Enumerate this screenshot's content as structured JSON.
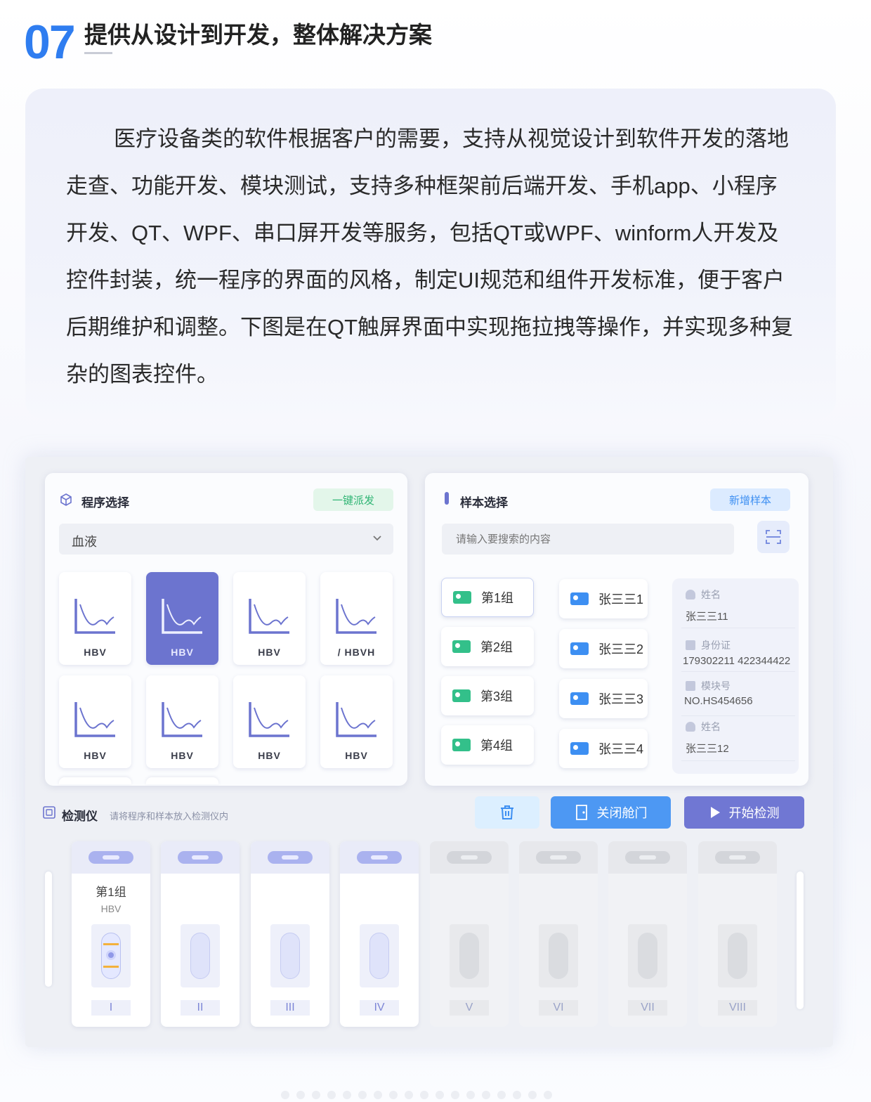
{
  "section": {
    "number": "07",
    "title": "提供从设计到开发，整体解决方案"
  },
  "intro": "医疗设备类的软件根据客户的需要，支持从视觉设计到软件开发的落地走查、功能开发、模块测试，支持多种框架前后端开发、手机app、小程序开发、QT、WPF、串口屏开发等服务，包括QT或WPF、winform人开发及控件封装，统一程序的界面的风格，制定UI规范和组件开发标准，便于客户后期维护和调整。下图是在QT触屏界面中实现拖拉拽等操作，并实现多种复杂的图表控件。",
  "program_panel": {
    "title": "程序选择",
    "dispatch_button": "一键派发",
    "dropdown_value": "血液",
    "cards": [
      {
        "label": "HBV",
        "selected": false
      },
      {
        "label": "HBV",
        "selected": true
      },
      {
        "label": "HBV",
        "selected": false
      },
      {
        "label": "/ HBVH",
        "selected": false
      },
      {
        "label": "HBV",
        "selected": false
      },
      {
        "label": "HBV",
        "selected": false
      },
      {
        "label": "HBV",
        "selected": false
      },
      {
        "label": "HBV",
        "selected": false
      }
    ]
  },
  "sample_panel": {
    "title": "样本选择",
    "add_button": "新增样本",
    "search_placeholder": "请输入要搜索的内容",
    "groups": [
      "第1组",
      "第2组",
      "第3组",
      "第4组"
    ],
    "people": [
      "张三三1",
      "张三三2",
      "张三三3",
      "张三三4"
    ],
    "info": [
      {
        "label": "姓名",
        "value": "张三三11"
      },
      {
        "label": "身份证",
        "value": "179302211 422344422"
      },
      {
        "label": "模块号",
        "value": "NO.HS454656"
      },
      {
        "label": "姓名",
        "value": "张三三12"
      }
    ]
  },
  "detector": {
    "title": "检测仪",
    "hint": "请将程序和样本放入检测仪内",
    "close_door": "关闭舱门",
    "start": "开始检测",
    "slots": [
      {
        "numeral": "I",
        "group": "第1组",
        "program": "HBV",
        "active": true
      },
      {
        "numeral": "II",
        "active": true
      },
      {
        "numeral": "III",
        "active": true
      },
      {
        "numeral": "IV",
        "active": true
      },
      {
        "numeral": "V",
        "active": false
      },
      {
        "numeral": "VI",
        "active": false
      },
      {
        "numeral": "VII",
        "active": false
      },
      {
        "numeral": "VIII",
        "active": false
      }
    ]
  },
  "colors": {
    "accent": "#2f7df0",
    "primary": "#6c74cf",
    "green": "#33c08a"
  }
}
